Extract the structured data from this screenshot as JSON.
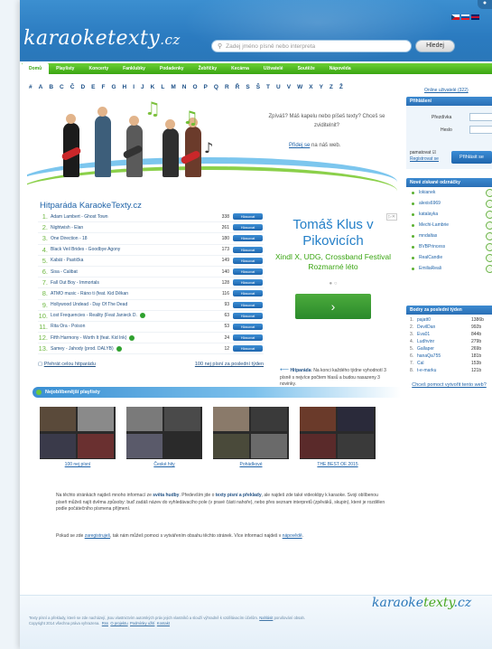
{
  "header": {
    "logo": "karaoketexty",
    "logo_domain": ".cz",
    "search_placeholder": "Zadej jméno písně nebo interpreta",
    "search_button": "Hledej"
  },
  "nav": [
    "Domů",
    "Playlisty",
    "Koncerty",
    "Fanklubky",
    "Podadenky",
    "Žebříčky",
    "Kecárna",
    "Uživatelé",
    "Soutěže",
    "Nápověda"
  ],
  "alphabet": [
    "#",
    "A",
    "B",
    "C",
    "Č",
    "D",
    "E",
    "F",
    "G",
    "H",
    "I",
    "J",
    "K",
    "L",
    "M",
    "N",
    "O",
    "P",
    "Q",
    "R",
    "Ř",
    "S",
    "Š",
    "T",
    "U",
    "V",
    "W",
    "X",
    "Y",
    "Z",
    "Ž"
  ],
  "hero": {
    "question": "Zpíváš? Máš kapelu nebo píšeš texty? Chceš se zviditelnit?",
    "join_link": "Přidej se",
    "join_rest": " na náš web."
  },
  "online_users": "Online uživatelé (322)",
  "login": {
    "title": "Přihlášení",
    "nick_label": "Přezdívka",
    "pass_label": "Heslo",
    "remember": "pamatovat",
    "register": "Registrovat se",
    "button": "Přihlásit se"
  },
  "translations": {
    "title": "Nové získané odznáčky",
    "items": [
      "lokianek",
      "alexis6969",
      "katalayka",
      "Mechi-Lambrie",
      "mndaltas",
      "BVBPrincess",
      "RealCandie",
      "EmiliaReali"
    ]
  },
  "best_users": {
    "title": "Bodry za poslední týden",
    "rows": [
      {
        "n": "1.",
        "user": "pajatt0",
        "score": "1386b"
      },
      {
        "n": "2.",
        "user": "DevilDan",
        "score": "992b"
      },
      {
        "n": "3.",
        "user": "Eva01",
        "score": "844b"
      },
      {
        "n": "4.",
        "user": "Ludhvinr",
        "score": "279b"
      },
      {
        "n": "5.",
        "user": "Gallaper",
        "score": "269b"
      },
      {
        "n": "6.",
        "user": "hanaQa755",
        "score": "181b"
      },
      {
        "n": "7.",
        "user": "Cal",
        "score": "153b"
      },
      {
        "n": "8.",
        "user": "t-e-marku",
        "score": "121b"
      }
    ],
    "foot": "Chceš pomoct vytvořit tento web?"
  },
  "chart": {
    "title": "Hitparáda KaraokeTexty.cz",
    "button_label": "Hlasovat",
    "rows": [
      {
        "num": "1.",
        "title": "Adam Lambert - Ghost Town",
        "score": "338",
        "dot": false
      },
      {
        "num": "2.",
        "title": "Nightwish - Élan",
        "score": "261",
        "dot": false
      },
      {
        "num": "3.",
        "title": "One Direction - 18",
        "score": "180",
        "dot": false
      },
      {
        "num": "4.",
        "title": "Black Veil Brides - Goodbye Agony",
        "score": "173",
        "dot": false
      },
      {
        "num": "5.",
        "title": "Kabát - Pastička",
        "score": "149",
        "dot": false
      },
      {
        "num": "6.",
        "title": "Sisa - Calibat",
        "score": "140",
        "dot": false
      },
      {
        "num": "7.",
        "title": "Fall Out Boy - Immortals",
        "score": "128",
        "dot": false
      },
      {
        "num": "8.",
        "title": "ATMO music - Ráno ti (feat. Kid Děkan",
        "score": "116",
        "dot": false
      },
      {
        "num": "9.",
        "title": "Hollywood Undead - Day Of The Dead",
        "score": "93",
        "dot": false
      },
      {
        "num": "10.",
        "title": "Lost Frequencies - Reality (Feat Janieck D.",
        "score": "63",
        "dot": true
      },
      {
        "num": "11.",
        "title": "Rita Ora - Poison",
        "score": "53",
        "dot": false
      },
      {
        "num": "12.",
        "title": "Fifth Harmony - Worth It (feat. Kid Ink)",
        "score": "24",
        "dot": true
      },
      {
        "num": "13.",
        "title": "Samey - Jahody (prod. DALYB)",
        "score": "12",
        "dot": true
      }
    ],
    "link_all": "Přehrát celou hitparádu",
    "link_new": "100 nej písní za poslední týden"
  },
  "ad": {
    "line1": "Tomáš Klus v Pikovicích",
    "line2": "Xindl X, UDG, Crossband Festival Rozmarné léto",
    "button": "›"
  },
  "hitparada_note": {
    "bold": "Hitparáda",
    "text": ": Na konci každého týdne vyhodnotí 3 písně s nejvíce počtem hlasů a budou nasazeny 3 novinky."
  },
  "playlists": {
    "title": "Nejoblíbenější playlisty",
    "items": [
      "100 nej písní",
      "České hity",
      "Pohádkové",
      "THE BEST OF 2015"
    ]
  },
  "desc": {
    "p1_a": "Na těchto stránkách najdeš mnoho informací ze ",
    "p1_b": "světa hudby",
    "p1_c": ". Především jde o ",
    "p1_d": "texty písní a překlady",
    "p1_e": ", ale najdeš zde také videoklipy k karaoke. Svoji oblíbenou píseň můžeš najít dvěma způsoby: buď zadáš název do vyhledávacího pole (v pravé části nahoře), nebo přes seznam interpretů (zpěváků, skupin), které je rozdělen podle počátečního písmena příjmení.",
    "p2_a": "Pokud se zde ",
    "p2_link1": "zaregistruješ",
    "p2_b": ", tak nám můžeš pomoci s vytvářením obsahu těchto stránek. Více informací najdeš v ",
    "p2_link2": "nápovědě",
    "p2_c": "."
  },
  "footer": {
    "logo_a": "karaoke",
    "logo_b": "texty",
    "logo_c": ".cz",
    "line1": "Texty písní a překlady, které se zde nacházejí, jsou vlastnictvím autorských práv jejich vlastníků a slouží výhradně k vzdělávacím účelům.",
    "line1_link": "Nahlásit",
    "line1_rest": "porušování obsah.",
    "line2": "Copyright 2014 všechna práva vyhrazena.",
    "link_rss": "Rss",
    "link_about": "O projektu",
    "link_terms": "Podmínky užití",
    "link_contact": "Kontakt"
  }
}
